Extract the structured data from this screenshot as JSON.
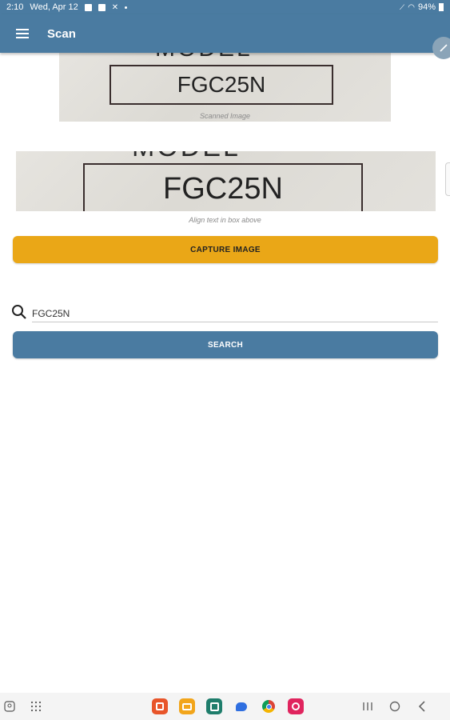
{
  "status_bar": {
    "time": "2:10",
    "date": "Wed, Apr 12",
    "battery": "94%"
  },
  "app_bar": {
    "title": "Scan",
    "menu_icon": "hamburger-menu-icon",
    "edit_icon": "pencil-icon"
  },
  "scanned_image": {
    "model_text": "MODEL",
    "box_text": "FGC25N",
    "caption": "Scanned Image"
  },
  "camera_preview": {
    "model_text": "MODEL",
    "box_text": "FGC25N",
    "caption": "Align text in box above"
  },
  "capture_button": {
    "label": "CAPTURE IMAGE"
  },
  "search": {
    "icon": "search-icon",
    "value": "FGC25N"
  },
  "search_button": {
    "label": "SEARCH"
  },
  "colors": {
    "primary": "#4a7ba1",
    "accent": "#eaa717"
  },
  "navbar": {
    "apps": [
      "bixby-vision-icon",
      "folder-icon",
      "calendar-icon",
      "messages-icon",
      "chrome-icon",
      "screen-recorder-icon"
    ],
    "system": [
      "recents-icon",
      "home-icon",
      "back-icon"
    ]
  }
}
